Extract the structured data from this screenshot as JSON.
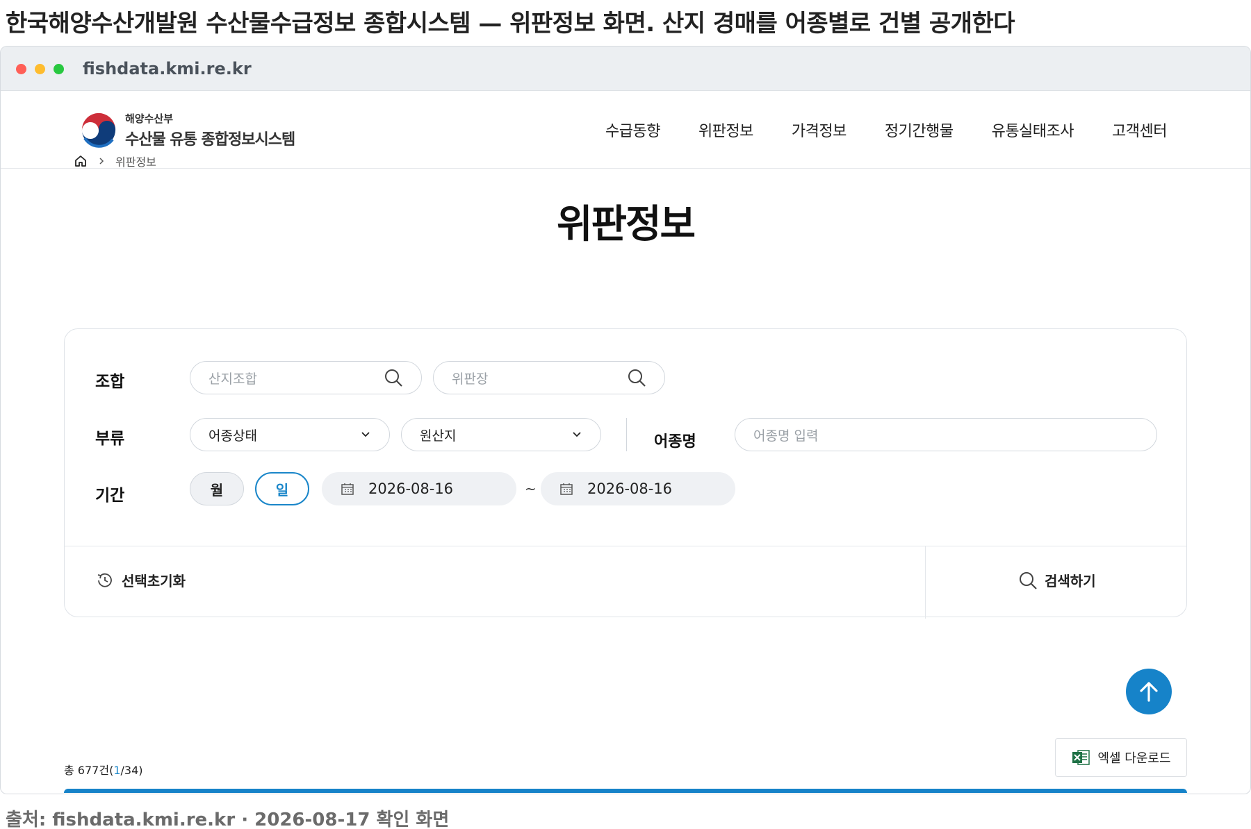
{
  "headline": "한국해양수산개발원 수산물수급정보 종합시스템 — 위판정보 화면. 산지 경매를 어종별로 건별 공개한다",
  "caption": "출처: fishdata.kmi.re.kr · 2026-08-17 확인 화면",
  "browser": {
    "url": "fishdata.kmi.re.kr"
  },
  "logo": {
    "sub": "해양수산부",
    "main": "수산물 유통 종합정보시스템"
  },
  "nav": [
    "수급동향",
    "위판정보",
    "가격정보",
    "정기간행물",
    "유통실태조사",
    "고객센터"
  ],
  "breadcrumb": {
    "current": "위판정보"
  },
  "page_title": "위판정보",
  "filters": {
    "union_label": "조합",
    "union_placeholder": "산지조합",
    "market_placeholder": "위판장",
    "category_label": "부류",
    "state_select": "어종상태",
    "origin_select": "원산지",
    "fish_label": "어종명",
    "fish_placeholder": "어종명 입력",
    "period_label": "기간",
    "month_btn": "월",
    "day_btn": "일",
    "date_from": "2026-08-16",
    "date_to": "2026-08-16",
    "tilde": "~"
  },
  "actions": {
    "reset": "선택초기화",
    "search": "검색하기"
  },
  "results": {
    "total_prefix": "총 677건(",
    "page_current": "1",
    "page_total": "/34)"
  },
  "excel_download": "엑셀 다운로드",
  "colors": {
    "accent": "#1683c9",
    "excel_green": "#1e7145"
  }
}
